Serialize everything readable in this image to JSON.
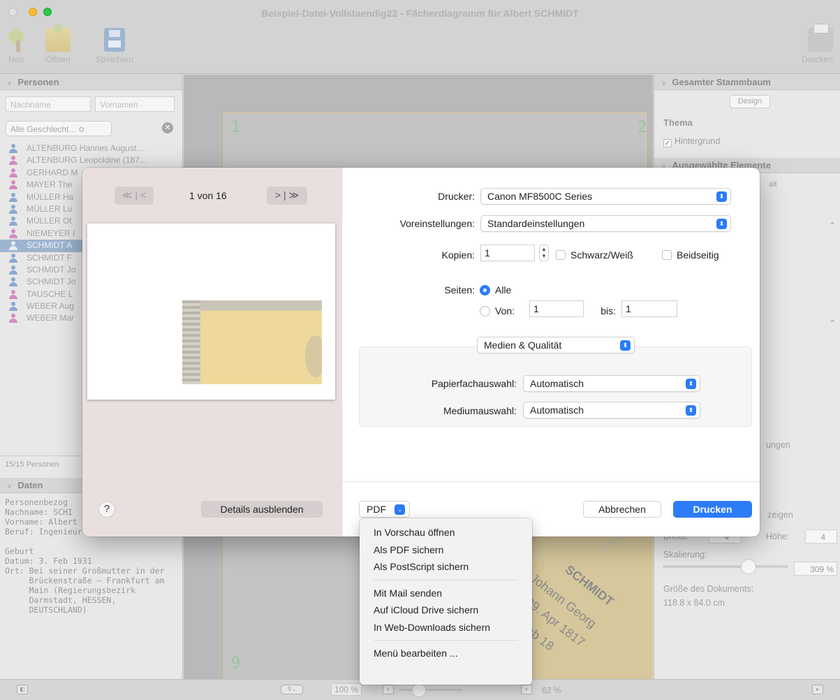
{
  "window": {
    "title": "Beispiel-Datei-Vollstaendig22 - Fächerdiagramm für Albert SCHMIDT",
    "toolbar": {
      "new": "Neu",
      "open": "Öffnen",
      "save": "Speichern",
      "print": "Drucken"
    }
  },
  "persons_panel": {
    "header": "Personen",
    "lastname_placeholder": "Nachname",
    "firstname_placeholder": "Vornamen",
    "gender_filter": "Alle Geschlecht... ≎",
    "items": [
      {
        "name": "ALTENBURG Hannes August...",
        "gender": "m"
      },
      {
        "name": "ALTENBURG Leopoldine (187...",
        "gender": "f"
      },
      {
        "name": "GERHARD M",
        "gender": "f"
      },
      {
        "name": "MAYER The",
        "gender": "f"
      },
      {
        "name": "MÜLLER Ha",
        "gender": "m"
      },
      {
        "name": "MÜLLER Lu",
        "gender": "m"
      },
      {
        "name": "MÜLLER Ot",
        "gender": "m"
      },
      {
        "name": "NIEMEYER I",
        "gender": "f"
      },
      {
        "name": "SCHMIDT A",
        "gender": "m"
      },
      {
        "name": "SCHMIDT F",
        "gender": "m"
      },
      {
        "name": "SCHMIDT Jo",
        "gender": "m"
      },
      {
        "name": "SCHMIDT Jo",
        "gender": "m"
      },
      {
        "name": "TAUSCHE L",
        "gender": "f"
      },
      {
        "name": "WEBER Aug",
        "gender": "m"
      },
      {
        "name": "WEBER Mar",
        "gender": "f"
      }
    ],
    "selected_index": 8,
    "count": "15/15 Personen"
  },
  "data_panel": {
    "header": "Daten",
    "lines": [
      "Personenbezog",
      "Nachname: SCHI",
      "Vorname: Albert",
      "Beruf: Ingenieur",
      "",
      "Geburt",
      "Datum: 3. Feb 1931",
      "Ort: Bei seiner Großmutter in der",
      "     Brückenstraße – Frankfurt am",
      "     Main (Regierungsbezirk",
      "     Darmstadt, HESSEN,",
      "     DEUTSCHLAND)"
    ]
  },
  "canvas": {
    "page_label_tl": "1",
    "page_label_tr": "2",
    "page_label_bl": "9",
    "fan_names": [
      "SCHMIDT",
      "Johann Georg",
      "29. Apr 1817",
      "Feb 18"
    ]
  },
  "right_panel": {
    "header_1": "Gesamter Stammbaum",
    "design_button": "Design",
    "theme_label": "Thema",
    "background_label": "Hintergrund",
    "header_2": "Ausgewählte Elemente",
    "tab_fragment": "alt",
    "settings_fragment": "ungen",
    "show_fragment": "zeigen",
    "width_label": "Breite:",
    "height_label": "Höhe:",
    "width_value": "4",
    "height_value": "4",
    "scaling_label": "Skalierung:",
    "scaling_value": "309 %",
    "doc_size_label": "Größe des Dokuments:",
    "doc_size_value": "118.8 x 84.0 cm"
  },
  "statusbar": {
    "zoom_field": "100 %",
    "zoom_percent": "62 %"
  },
  "print_dialog": {
    "nav_back": "≪ | <",
    "nav_forward": "> | ≫",
    "page_indicator": "1 von 16",
    "help": "?",
    "details_button": "Details ausblenden",
    "printer_label": "Drucker:",
    "printer_value": "Canon MF8500C Series",
    "presets_label": "Voreinstellungen:",
    "presets_value": "Standardeinstellungen",
    "copies_label": "Kopien:",
    "copies_value": "1",
    "bw_label": "Schwarz/Weiß",
    "duplex_label": "Beidseitig",
    "pages_label": "Seiten:",
    "pages_all": "Alle",
    "pages_from_label": "Von:",
    "pages_from_value": "1",
    "pages_to_label": "bis:",
    "pages_to_value": "1",
    "section_value": "Medien & Qualität",
    "tray_label": "Papierfachauswahl:",
    "tray_value": "Automatisch",
    "media_label": "Mediumauswahl:",
    "media_value": "Automatisch",
    "pdf_button": "PDF",
    "cancel_button": "Abbrechen",
    "print_button": "Drucken"
  },
  "pdf_menu": {
    "group1": [
      "In Vorschau öffnen",
      "Als PDF sichern",
      "Als PostScript sichern"
    ],
    "group2": [
      "Mit Mail senden",
      "Auf iCloud Drive sichern",
      "In Web-Downloads sichern"
    ],
    "group3": [
      "Menü bearbeiten ..."
    ]
  },
  "colors": {
    "accent": "#2b7cf6",
    "selection": "#9eb5d0",
    "male_icon": "#8aa9d1",
    "female_icon": "#d38ac3"
  }
}
